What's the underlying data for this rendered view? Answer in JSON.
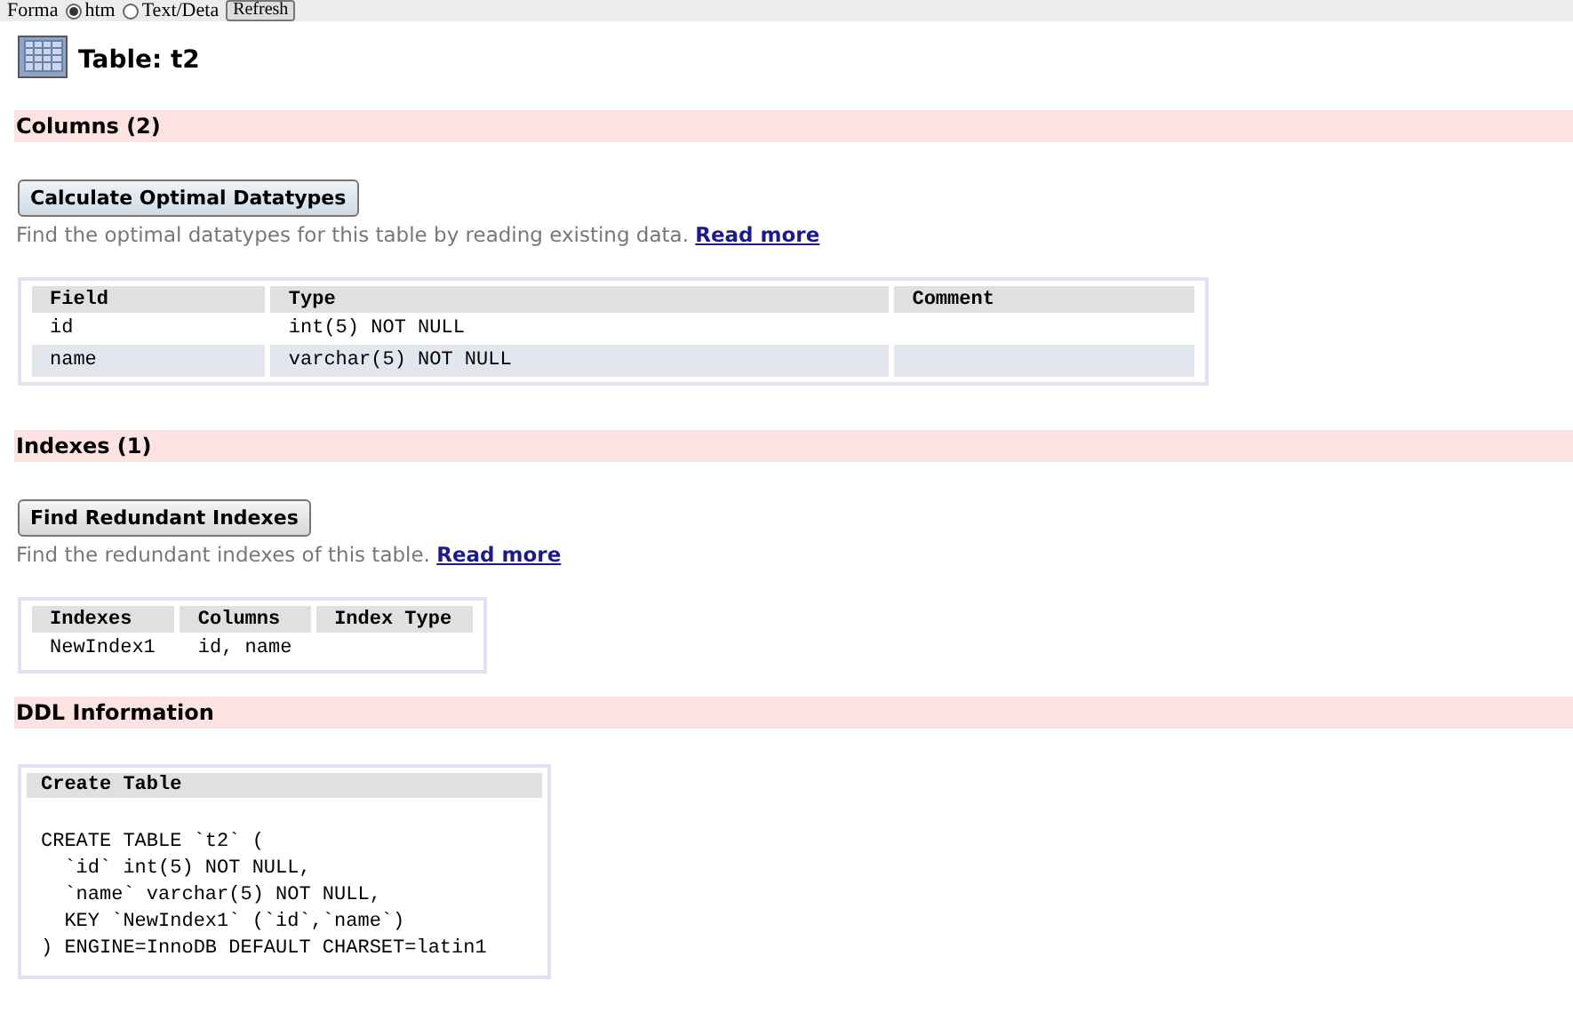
{
  "top_bar": {
    "format_label": "Forma",
    "options": [
      {
        "label": "htm",
        "selected": true
      },
      {
        "label": "Text/Deta",
        "selected": false
      }
    ],
    "refresh_button": "Refresh"
  },
  "title": "Table: t2",
  "columns_section": {
    "heading": "Columns (2)",
    "button": "Calculate Optimal Datatypes",
    "description": "Find the optimal datatypes for this table by reading existing data.",
    "link": "Read more",
    "table": {
      "columns": [
        "Field",
        "Type",
        "Comment"
      ],
      "rows": [
        {
          "cells": [
            "id",
            "int(5) NOT NULL",
            ""
          ]
        },
        {
          "cells": [
            "name",
            "varchar(5) NOT NULL",
            ""
          ]
        }
      ]
    }
  },
  "indexes_section": {
    "heading": "Indexes (1)",
    "button": "Find Redundant Indexes",
    "description": "Find the redundant indexes of this table.",
    "link": "Read more",
    "table": {
      "columns": [
        "Indexes",
        "Columns",
        "Index Type"
      ],
      "rows": [
        {
          "cells": [
            "NewIndex1",
            "id, name",
            ""
          ]
        }
      ]
    }
  },
  "ddl_section": {
    "heading": "DDL Information",
    "box_title": "Create Table",
    "code": [
      "CREATE TABLE `t2` (",
      "  `id` int(5) NOT NULL,",
      "  `name` varchar(5) NOT NULL,",
      "  KEY `NewIndex1` (`id`,`name`)",
      ") ENGINE=InnoDB DEFAULT CHARSET=latin1"
    ]
  }
}
